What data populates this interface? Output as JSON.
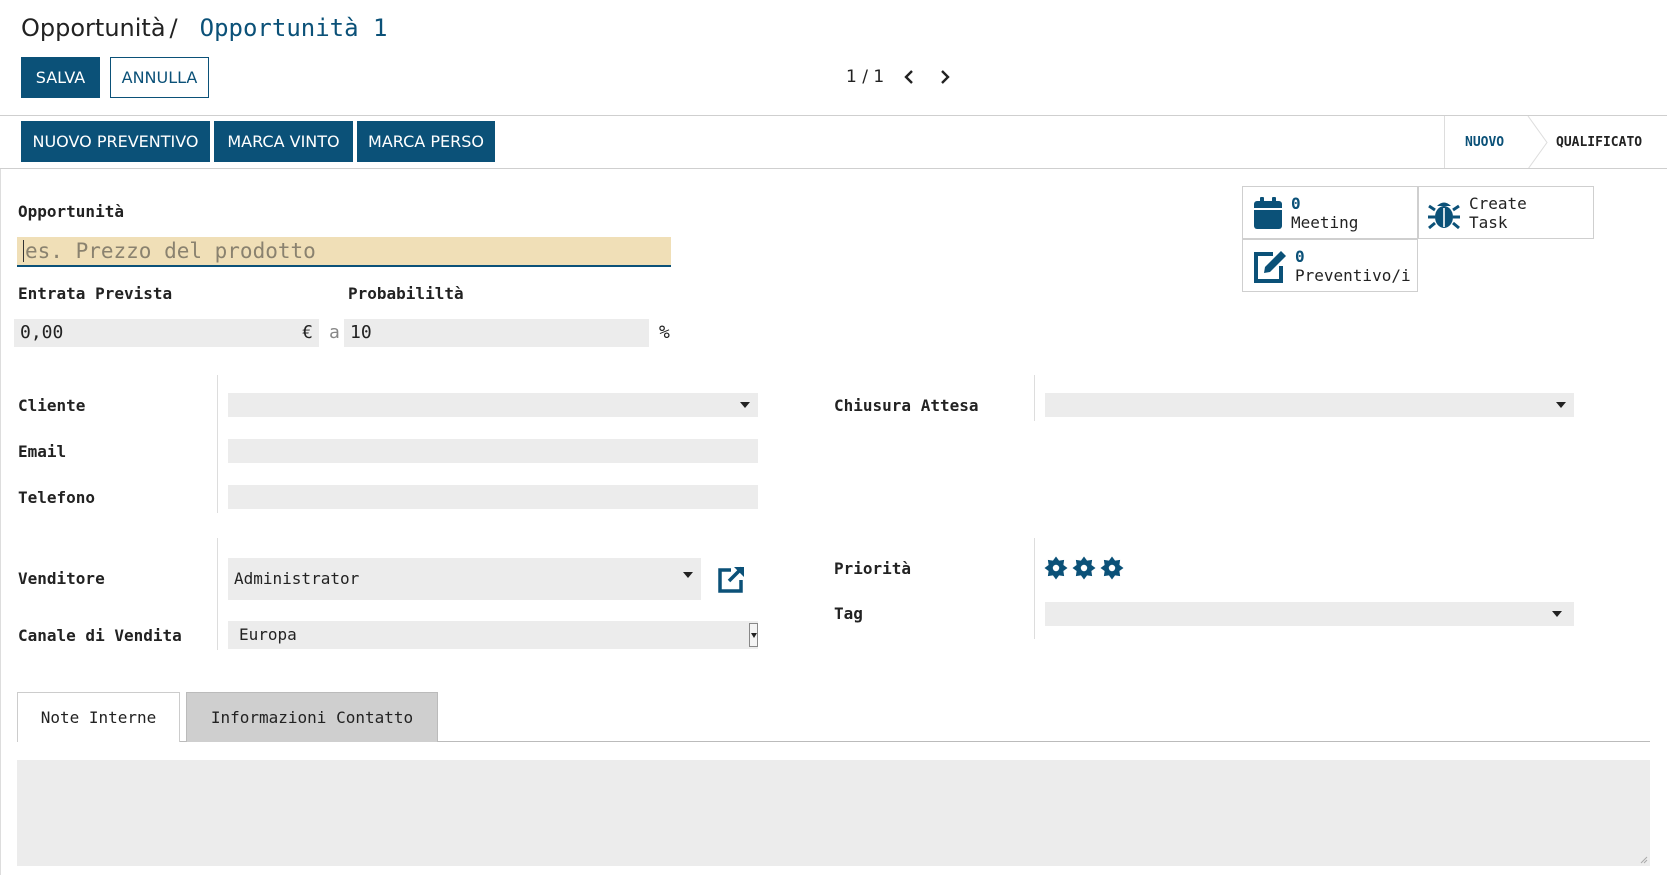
{
  "breadcrumb": {
    "root": "Opportunità",
    "separator": "/",
    "current": "Opportunità 1"
  },
  "actions": {
    "save": "SALVA",
    "discard": "ANNULLA"
  },
  "pager": {
    "value": "1 / 1"
  },
  "header_buttons": {
    "new_quotation": "NUOVO PREVENTIVO",
    "mark_won": "MARCA VINTO",
    "mark_lost": "MARCA PERSO"
  },
  "stages": {
    "active": "NUOVO",
    "next": "QUALIFICATO"
  },
  "smart_buttons": {
    "meeting": {
      "count": "0",
      "label": "Meeting",
      "icon": "calendar-icon"
    },
    "create_task": {
      "label_1": "Create",
      "label_2": "Task",
      "icon": "bug-icon"
    },
    "quotations": {
      "count": "0",
      "label": "Preventivo/i",
      "icon": "edit-icon"
    }
  },
  "form": {
    "name_label": "Opportunità",
    "name_placeholder": "es. Prezzo del prodotto",
    "expected_revenue_label": "Entrata Prevista",
    "expected_revenue_value": "0,00",
    "currency": "€",
    "at": "a",
    "probability_label": "Probabililtà",
    "probability_value": "10",
    "percent": "%",
    "customer_label": "Cliente",
    "email_label": "Email",
    "phone_label": "Telefono",
    "expected_closing_label": "Chiusura Attesa",
    "salesperson_label": "Venditore",
    "salesperson_value": "Administrator",
    "sales_channel_label": "Canale di Vendita",
    "sales_channel_value": "Europa",
    "priority_label": "Priorità",
    "priority_stars": 3,
    "tag_label": "Tag"
  },
  "tabs": [
    {
      "label": "Note Interne",
      "active": true
    },
    {
      "label": "Informazioni Contatto",
      "active": false
    }
  ],
  "colors": {
    "primary": "#0b5178",
    "field_bg": "#ececec",
    "required_bg": "#f0dfb7"
  }
}
